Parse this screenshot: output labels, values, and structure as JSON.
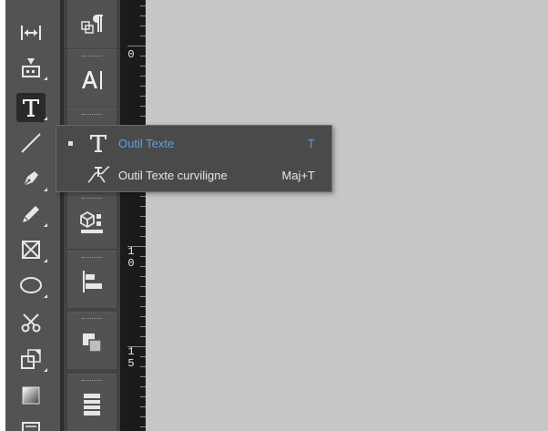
{
  "tools": {
    "items": [
      {
        "name": "gap-tool",
        "active": false
      },
      {
        "name": "content-collector-tool",
        "active": false
      },
      {
        "name": "type-tool",
        "active": true
      },
      {
        "name": "line-tool",
        "active": false
      },
      {
        "name": "pen-tool",
        "active": false
      },
      {
        "name": "pencil-tool",
        "active": false
      },
      {
        "name": "rectangle-frame-tool",
        "active": false
      },
      {
        "name": "ellipse-tool",
        "active": false
      },
      {
        "name": "scissors-tool",
        "active": false
      },
      {
        "name": "free-transform-tool",
        "active": false
      },
      {
        "name": "gradient-swatch-tool",
        "active": false
      }
    ]
  },
  "panels": {
    "items": [
      "paragraph-styles",
      "character-styles",
      "object-styles",
      "align",
      "pathfinder",
      "stroke"
    ]
  },
  "ruler": {
    "labels": [
      "0",
      "1",
      "0",
      "1",
      "5"
    ]
  },
  "flyout": {
    "items": [
      {
        "label": "Outil Texte",
        "shortcut": "T",
        "selected": true
      },
      {
        "label": "Outil Texte curviligne",
        "shortcut": "Maj+T",
        "selected": false
      }
    ]
  },
  "colors": {
    "selected_text": "#5aa0e8",
    "canvas": "#c6c6c6",
    "tools_panel": "#535353"
  }
}
